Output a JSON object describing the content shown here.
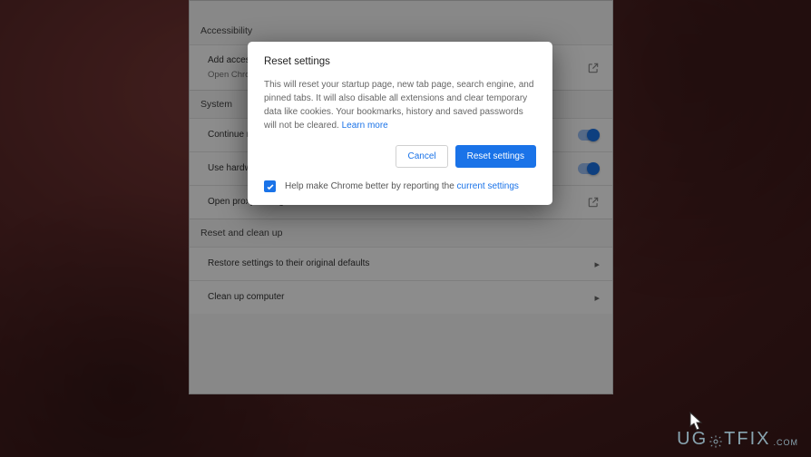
{
  "settings": {
    "accessibility": {
      "header": "Accessibility",
      "item": {
        "title": "Add accessibility features",
        "subtitle": "Open Chrome Web Store"
      }
    },
    "system": {
      "header": "System",
      "items": [
        {
          "label": "Continue running background apps when Google Chrome is closed"
        },
        {
          "label": "Use hardware acceleration when available"
        },
        {
          "label": "Open proxy settings"
        }
      ]
    },
    "reset": {
      "header": "Reset and clean up",
      "items": [
        {
          "label": "Restore settings to their original defaults"
        },
        {
          "label": "Clean up computer"
        }
      ]
    }
  },
  "dialog": {
    "title": "Reset settings",
    "body": "This will reset your startup page, new tab page, search engine, and pinned tabs. It will also disable all extensions and clear temporary data like cookies. Your bookmarks, history and saved passwords will not be cleared. ",
    "learn_more": "Learn more",
    "cancel": "Cancel",
    "confirm": "Reset settings",
    "checkbox_text_pre": "Help make Chrome better by reporting the ",
    "checkbox_link": "current settings"
  },
  "watermark": {
    "pre": "UG",
    "post": "TFIX",
    "tld": ".COM"
  }
}
